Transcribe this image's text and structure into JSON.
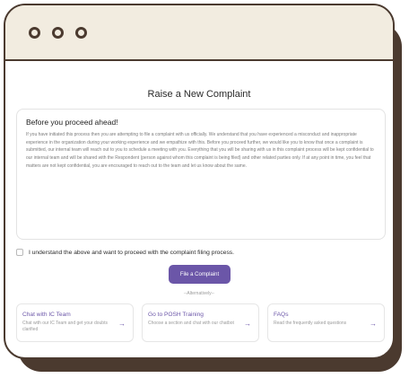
{
  "page": {
    "title": "Raise a New Complaint"
  },
  "notice": {
    "heading": "Before you proceed ahead!",
    "body": "If you have initiated this process then you are attempting to file a complaint with us officially. We understand that you have experienced a misconduct and inappropriate experience in the organization during your working experience and we empathize with this. Before you proceed further, we would like you to know that once a complaint is submitted, our internal team will reach out to you to schedule a meeting with you. Everything that you will be sharing with us in this complaint process will be kept confidential to our internal team and will be shared with the Respondent (person against whom this complaint is being filed) and other related parties only. If at any point in time, you feel that matters are not kept confidential, you are encouraged to reach out to the team and let us know about the same."
  },
  "consent": {
    "label": "I understand the above and want to proceed with the complaint filing process.",
    "checked": false
  },
  "actions": {
    "file_label": "File a Complaint",
    "alternatively": "--Alternatively--"
  },
  "options": [
    {
      "title": "Chat with IC Team",
      "desc": "Chat with our IC Team and get your doubts clarified",
      "icon": "arrow-right-icon"
    },
    {
      "title": "Go to POSH Training",
      "desc": "Choose a section and chat with our chatbot",
      "icon": "arrow-right-icon"
    },
    {
      "title": "FAQs",
      "desc": "Read the frequently asked questions",
      "icon": "arrow-right-icon"
    }
  ],
  "colors": {
    "accent": "#6b56a8",
    "frame": "#4b3a2f",
    "titlebar": "#f2ece0"
  }
}
